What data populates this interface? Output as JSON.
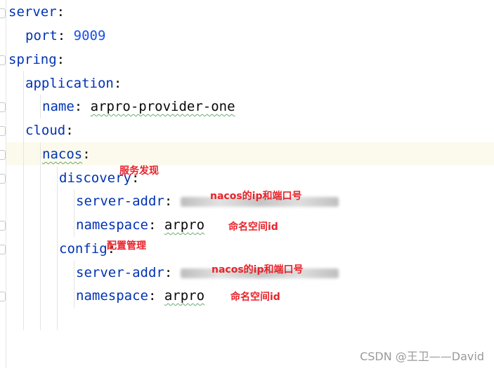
{
  "editor": {
    "lines": [
      {
        "key": "server",
        "sep": ":"
      },
      {
        "key": "port",
        "sep": ": ",
        "value": "9009"
      },
      {
        "key": "spring",
        "sep": ":"
      },
      {
        "key": "application",
        "sep": ":"
      },
      {
        "key": "name",
        "sep": ": ",
        "value": "arpro-provider-one"
      },
      {
        "key": "cloud",
        "sep": ":"
      },
      {
        "key": "nacos",
        "sep": ":"
      },
      {
        "key": "discovery",
        "sep": ":"
      },
      {
        "key": "server-addr",
        "sep": ": "
      },
      {
        "key": "namespace",
        "sep": ": ",
        "value": "arpro"
      },
      {
        "key": "config",
        "sep": ":"
      },
      {
        "key": "server-addr",
        "sep": ": "
      },
      {
        "key": "namespace",
        "sep": ": ",
        "value": "arpro"
      }
    ]
  },
  "annotations": {
    "service_discovery": "服务发现",
    "nacos_ip_port_1": "nacos的ip和端口号",
    "namespace_id_1": "命名空间id",
    "config_management": "配置管理",
    "nacos_ip_port_2": "nacos的ip和端口号",
    "namespace_id_2": "命名空间id"
  },
  "watermark": "CSDN @王卫——David",
  "colors": {
    "key": "#0033b3",
    "number": "#1750eb",
    "annotation": "#e8232a",
    "current_line": "#fcfaed"
  }
}
